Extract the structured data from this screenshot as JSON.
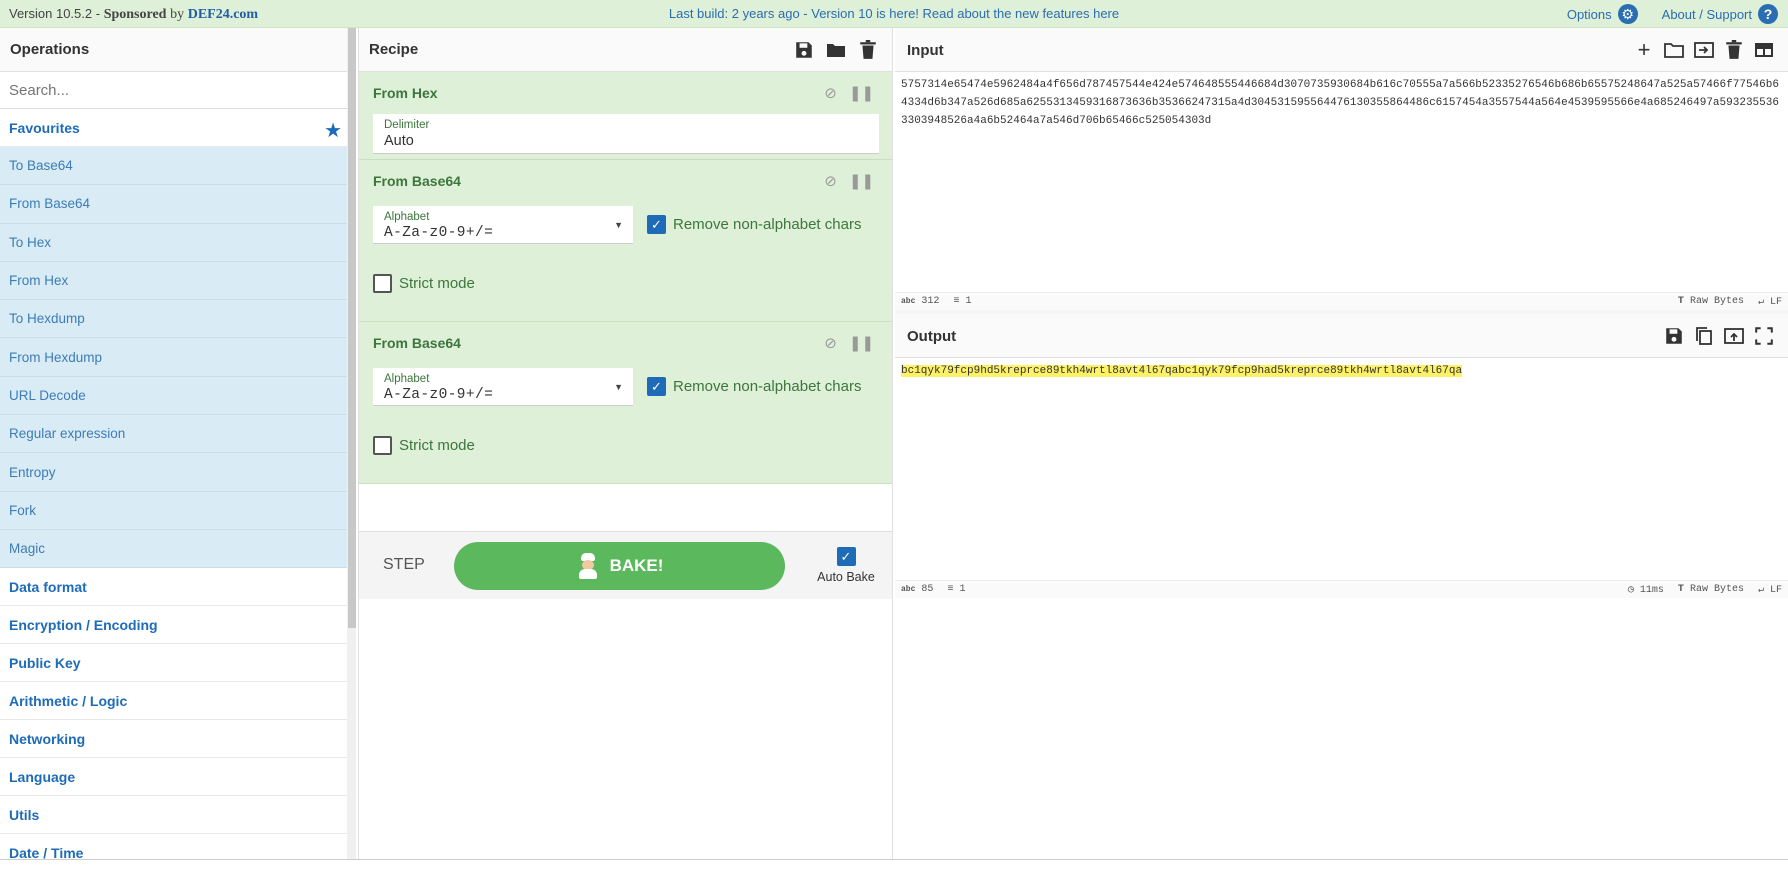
{
  "banner": {
    "version": "Version 10.5.2",
    "sponsored": "Sponsored",
    "by": "by",
    "sponsor": "DEF24.com",
    "center": "Last build: 2 years ago - Version 10 is here! Read about the new features here",
    "options": "Options",
    "about": "About / Support"
  },
  "operations": {
    "title": "Operations",
    "search_placeholder": "Search...",
    "favourites": "Favourites",
    "items": [
      "To Base64",
      "From Base64",
      "To Hex",
      "From Hex",
      "To Hexdump",
      "From Hexdump",
      "URL Decode",
      "Regular expression",
      "Entropy",
      "Fork",
      "Magic"
    ],
    "categories": [
      "Data format",
      "Encryption / Encoding",
      "Public Key",
      "Arithmetic / Logic",
      "Networking",
      "Language",
      "Utils",
      "Date / Time"
    ]
  },
  "recipe": {
    "title": "Recipe",
    "ops": [
      {
        "title": "From Hex",
        "field_label": "Delimiter",
        "field_value": "Auto"
      },
      {
        "title": "From Base64",
        "field_label": "Alphabet",
        "field_value": "A-Za-z0-9+/=",
        "checkbox_label": "Remove non-alphabet chars",
        "strict_label": "Strict mode"
      },
      {
        "title": "From Base64",
        "field_label": "Alphabet",
        "field_value": "A-Za-z0-9+/=",
        "checkbox_label": "Remove non-alphabet chars",
        "strict_label": "Strict mode"
      }
    ],
    "step": "STEP",
    "bake": "BAKE!",
    "auto_bake": "Auto Bake"
  },
  "input": {
    "title": "Input",
    "text": "5757314e65474e5962484a4f656d787457544e424e574648555446684d3070735930684b616c70555a7a566b52335276546b686b65575248647a525a57466f77546b64334d6b347a526d685a6255313459316873636b35366247315a4d304531595564476130355864486c6157454a3557544a564e4539595566e4a685246497a5932355363303948526a4a6b52464a7a546d706b65466c525054303d",
    "chars": "312",
    "lines": "1",
    "encoding": "Raw Bytes",
    "eol": "LF"
  },
  "output": {
    "title": "Output",
    "text": "bc1qyk79fcp9hd5kreprce89tkh4wrtl8avt4l67qabc1qyk79fcp9had5kreprce89tkh4wrtl8avt4l67qa",
    "chars": "85",
    "lines": "1",
    "time": "11ms",
    "encoding": "Raw Bytes",
    "eol": "LF"
  },
  "colors": {
    "banner": "#dff0d8",
    "accent": "#1e6bb8",
    "recipe_bg": "#dff0d8",
    "fav_bg": "#d9ecf5",
    "bake": "#5cb85c",
    "highlight": "#fdf266"
  }
}
